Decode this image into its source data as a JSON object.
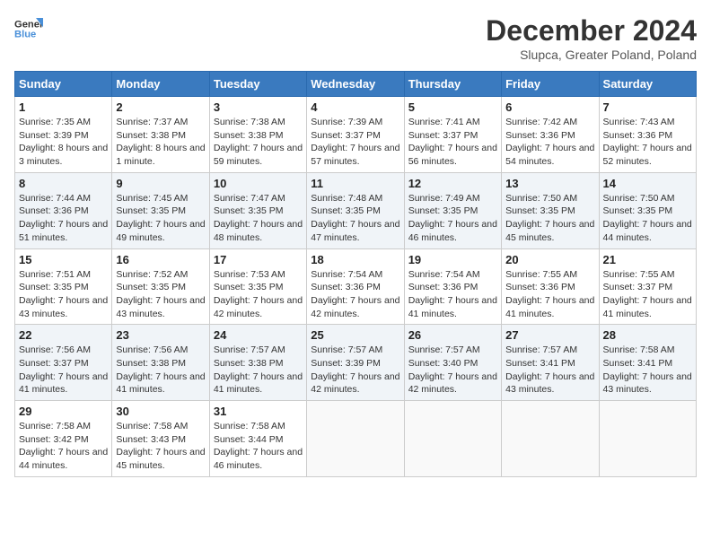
{
  "header": {
    "logo_line1": "General",
    "logo_line2": "Blue",
    "month": "December 2024",
    "location": "Slupca, Greater Poland, Poland"
  },
  "weekdays": [
    "Sunday",
    "Monday",
    "Tuesday",
    "Wednesday",
    "Thursday",
    "Friday",
    "Saturday"
  ],
  "weeks": [
    [
      {
        "day": "1",
        "sunrise": "Sunrise: 7:35 AM",
        "sunset": "Sunset: 3:39 PM",
        "daylight": "Daylight: 8 hours and 3 minutes."
      },
      {
        "day": "2",
        "sunrise": "Sunrise: 7:37 AM",
        "sunset": "Sunset: 3:38 PM",
        "daylight": "Daylight: 8 hours and 1 minute."
      },
      {
        "day": "3",
        "sunrise": "Sunrise: 7:38 AM",
        "sunset": "Sunset: 3:38 PM",
        "daylight": "Daylight: 7 hours and 59 minutes."
      },
      {
        "day": "4",
        "sunrise": "Sunrise: 7:39 AM",
        "sunset": "Sunset: 3:37 PM",
        "daylight": "Daylight: 7 hours and 57 minutes."
      },
      {
        "day": "5",
        "sunrise": "Sunrise: 7:41 AM",
        "sunset": "Sunset: 3:37 PM",
        "daylight": "Daylight: 7 hours and 56 minutes."
      },
      {
        "day": "6",
        "sunrise": "Sunrise: 7:42 AM",
        "sunset": "Sunset: 3:36 PM",
        "daylight": "Daylight: 7 hours and 54 minutes."
      },
      {
        "day": "7",
        "sunrise": "Sunrise: 7:43 AM",
        "sunset": "Sunset: 3:36 PM",
        "daylight": "Daylight: 7 hours and 52 minutes."
      }
    ],
    [
      {
        "day": "8",
        "sunrise": "Sunrise: 7:44 AM",
        "sunset": "Sunset: 3:36 PM",
        "daylight": "Daylight: 7 hours and 51 minutes."
      },
      {
        "day": "9",
        "sunrise": "Sunrise: 7:45 AM",
        "sunset": "Sunset: 3:35 PM",
        "daylight": "Daylight: 7 hours and 49 minutes."
      },
      {
        "day": "10",
        "sunrise": "Sunrise: 7:47 AM",
        "sunset": "Sunset: 3:35 PM",
        "daylight": "Daylight: 7 hours and 48 minutes."
      },
      {
        "day": "11",
        "sunrise": "Sunrise: 7:48 AM",
        "sunset": "Sunset: 3:35 PM",
        "daylight": "Daylight: 7 hours and 47 minutes."
      },
      {
        "day": "12",
        "sunrise": "Sunrise: 7:49 AM",
        "sunset": "Sunset: 3:35 PM",
        "daylight": "Daylight: 7 hours and 46 minutes."
      },
      {
        "day": "13",
        "sunrise": "Sunrise: 7:50 AM",
        "sunset": "Sunset: 3:35 PM",
        "daylight": "Daylight: 7 hours and 45 minutes."
      },
      {
        "day": "14",
        "sunrise": "Sunrise: 7:50 AM",
        "sunset": "Sunset: 3:35 PM",
        "daylight": "Daylight: 7 hours and 44 minutes."
      }
    ],
    [
      {
        "day": "15",
        "sunrise": "Sunrise: 7:51 AM",
        "sunset": "Sunset: 3:35 PM",
        "daylight": "Daylight: 7 hours and 43 minutes."
      },
      {
        "day": "16",
        "sunrise": "Sunrise: 7:52 AM",
        "sunset": "Sunset: 3:35 PM",
        "daylight": "Daylight: 7 hours and 43 minutes."
      },
      {
        "day": "17",
        "sunrise": "Sunrise: 7:53 AM",
        "sunset": "Sunset: 3:35 PM",
        "daylight": "Daylight: 7 hours and 42 minutes."
      },
      {
        "day": "18",
        "sunrise": "Sunrise: 7:54 AM",
        "sunset": "Sunset: 3:36 PM",
        "daylight": "Daylight: 7 hours and 42 minutes."
      },
      {
        "day": "19",
        "sunrise": "Sunrise: 7:54 AM",
        "sunset": "Sunset: 3:36 PM",
        "daylight": "Daylight: 7 hours and 41 minutes."
      },
      {
        "day": "20",
        "sunrise": "Sunrise: 7:55 AM",
        "sunset": "Sunset: 3:36 PM",
        "daylight": "Daylight: 7 hours and 41 minutes."
      },
      {
        "day": "21",
        "sunrise": "Sunrise: 7:55 AM",
        "sunset": "Sunset: 3:37 PM",
        "daylight": "Daylight: 7 hours and 41 minutes."
      }
    ],
    [
      {
        "day": "22",
        "sunrise": "Sunrise: 7:56 AM",
        "sunset": "Sunset: 3:37 PM",
        "daylight": "Daylight: 7 hours and 41 minutes."
      },
      {
        "day": "23",
        "sunrise": "Sunrise: 7:56 AM",
        "sunset": "Sunset: 3:38 PM",
        "daylight": "Daylight: 7 hours and 41 minutes."
      },
      {
        "day": "24",
        "sunrise": "Sunrise: 7:57 AM",
        "sunset": "Sunset: 3:38 PM",
        "daylight": "Daylight: 7 hours and 41 minutes."
      },
      {
        "day": "25",
        "sunrise": "Sunrise: 7:57 AM",
        "sunset": "Sunset: 3:39 PM",
        "daylight": "Daylight: 7 hours and 42 minutes."
      },
      {
        "day": "26",
        "sunrise": "Sunrise: 7:57 AM",
        "sunset": "Sunset: 3:40 PM",
        "daylight": "Daylight: 7 hours and 42 minutes."
      },
      {
        "day": "27",
        "sunrise": "Sunrise: 7:57 AM",
        "sunset": "Sunset: 3:41 PM",
        "daylight": "Daylight: 7 hours and 43 minutes."
      },
      {
        "day": "28",
        "sunrise": "Sunrise: 7:58 AM",
        "sunset": "Sunset: 3:41 PM",
        "daylight": "Daylight: 7 hours and 43 minutes."
      }
    ],
    [
      {
        "day": "29",
        "sunrise": "Sunrise: 7:58 AM",
        "sunset": "Sunset: 3:42 PM",
        "daylight": "Daylight: 7 hours and 44 minutes."
      },
      {
        "day": "30",
        "sunrise": "Sunrise: 7:58 AM",
        "sunset": "Sunset: 3:43 PM",
        "daylight": "Daylight: 7 hours and 45 minutes."
      },
      {
        "day": "31",
        "sunrise": "Sunrise: 7:58 AM",
        "sunset": "Sunset: 3:44 PM",
        "daylight": "Daylight: 7 hours and 46 minutes."
      },
      null,
      null,
      null,
      null
    ]
  ]
}
